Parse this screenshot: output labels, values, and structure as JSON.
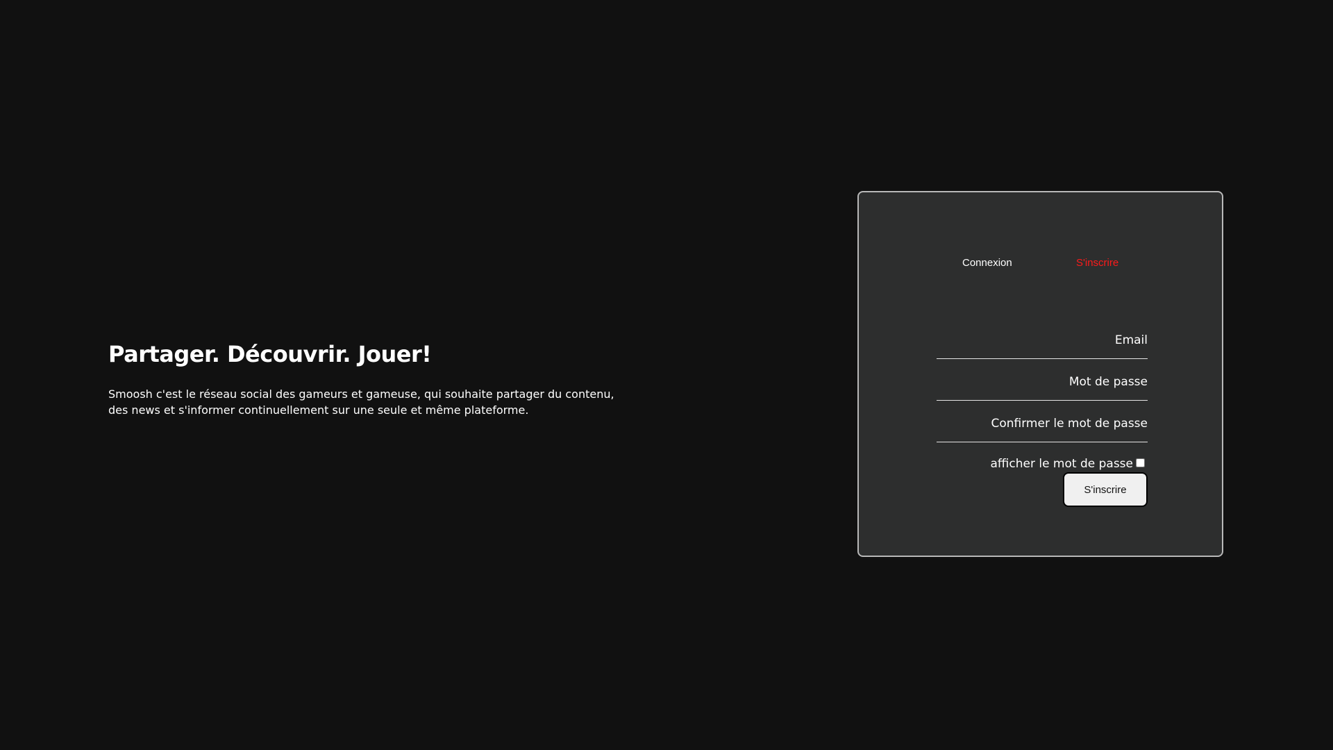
{
  "hero": {
    "title": "Partager. Découvrir. Jouer!",
    "description": "Smoosh c'est le réseau social des gameurs et gameuse, qui souhaite partager du contenu, des news et s'informer continuellement sur une seule et même plateforme."
  },
  "auth": {
    "tabs": {
      "login": "Connexion",
      "signup": "S'inscrire",
      "active": "signup"
    },
    "form": {
      "email_placeholder": "Email",
      "password_placeholder": "Mot de passe",
      "confirm_password_placeholder": "Confirmer le mot de passe",
      "show_password_label": "afficher le mot de passe",
      "show_password_checked": false,
      "submit_label": "S'inscrire"
    }
  },
  "colors": {
    "background": "#111111",
    "card": "#2d2e2e",
    "active_tab": "#ff1a1a"
  }
}
